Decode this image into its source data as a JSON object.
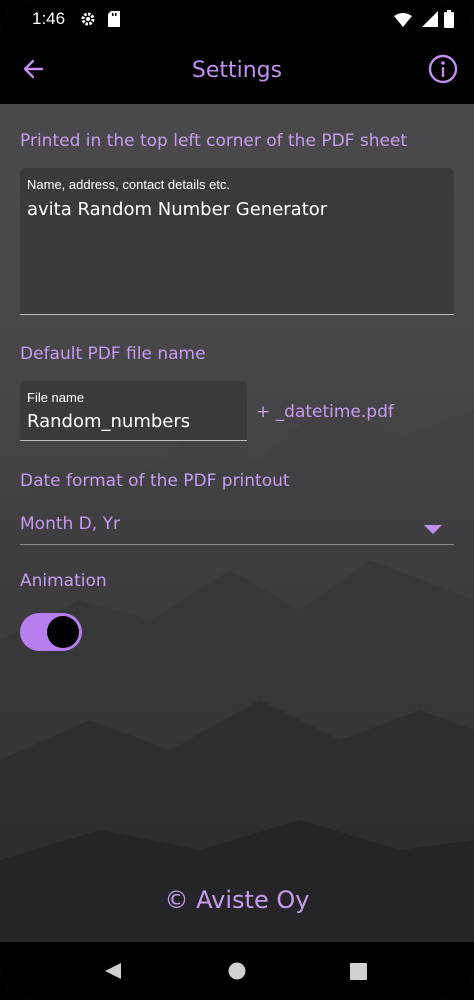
{
  "status_bar": {
    "time": "1:46"
  },
  "app_bar": {
    "title": "Settings"
  },
  "header_section": {
    "label": "Printed in the top left corner of the PDF sheet",
    "field_label": "Name, address, contact details etc.",
    "field_value": "avita Random Number Generator"
  },
  "file_section": {
    "label": "Default PDF file name",
    "field_label": "File name",
    "field_value": "Random_numbers",
    "suffix": "+ _datetime.pdf"
  },
  "date_section": {
    "label": "Date format of the PDF printout",
    "selected": "Month D, Yr"
  },
  "animation_section": {
    "label": "Animation",
    "enabled": true
  },
  "footer": {
    "copyright": "© Aviste Oy"
  },
  "colors": {
    "accent": "#c28ef0",
    "toggle_track": "#b87df0",
    "bar": "#000000"
  }
}
